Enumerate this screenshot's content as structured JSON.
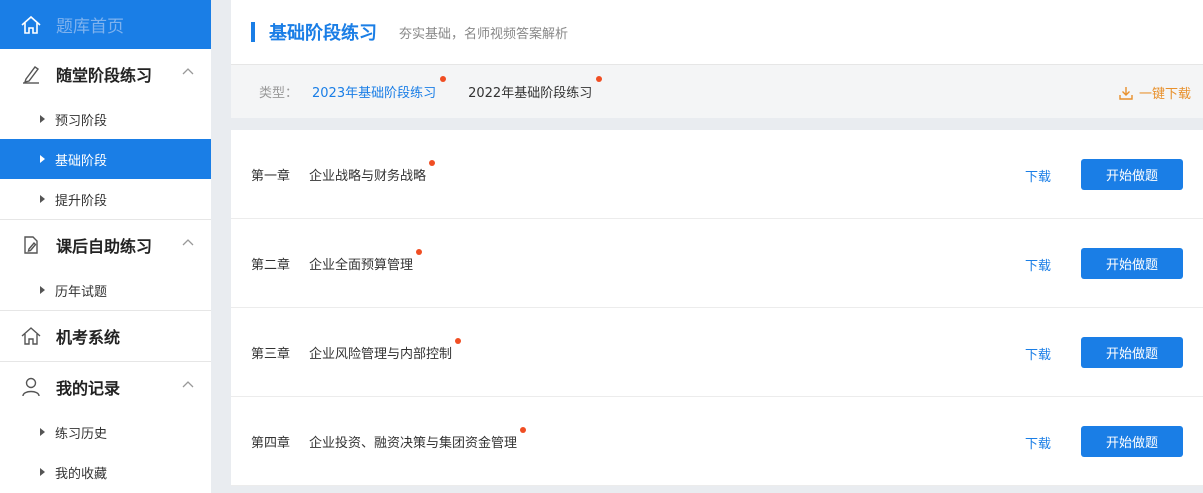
{
  "sidebar": {
    "home": {
      "label": "题库首页",
      "icon": "home-icon"
    },
    "groups": [
      {
        "label": "随堂阶段练习",
        "icon": "pencil-icon",
        "items": [
          {
            "label": "预习阶段",
            "active": false
          },
          {
            "label": "基础阶段",
            "active": true
          },
          {
            "label": "提升阶段",
            "active": false
          }
        ]
      },
      {
        "label": "课后自助练习",
        "icon": "document-edit-icon",
        "items": [
          {
            "label": "历年试题",
            "active": false
          }
        ]
      },
      {
        "label": "机考系统",
        "icon": "home-icon",
        "items": []
      },
      {
        "label": "我的记录",
        "icon": "user-icon",
        "items": [
          {
            "label": "练习历史",
            "active": false
          },
          {
            "label": "我的收藏",
            "active": false
          }
        ]
      }
    ]
  },
  "header": {
    "title": "基础阶段练习",
    "subtitle": "夯实基础，名师视频答案解析"
  },
  "filter": {
    "type_label": "类型：",
    "options": [
      {
        "label": "2023年基础阶段练习",
        "active": true
      },
      {
        "label": "2022年基础阶段练习",
        "active": false
      }
    ],
    "download_all": "一键下载"
  },
  "chapters": [
    {
      "chapter": "第一章",
      "name": "企业战略与财务战略",
      "download": "下载",
      "start": "开始做题"
    },
    {
      "chapter": "第二章",
      "name": "企业全面预算管理",
      "download": "下载",
      "start": "开始做题"
    },
    {
      "chapter": "第三章",
      "name": "企业风险管理与内部控制",
      "download": "下载",
      "start": "开始做题"
    },
    {
      "chapter": "第四章",
      "name": "企业投资、融资决策与集团资金管理",
      "download": "下载",
      "start": "开始做题"
    }
  ],
  "colors": {
    "primary": "#1a7ee6",
    "badge": "#f04e23",
    "download_all": "#e8902b"
  }
}
